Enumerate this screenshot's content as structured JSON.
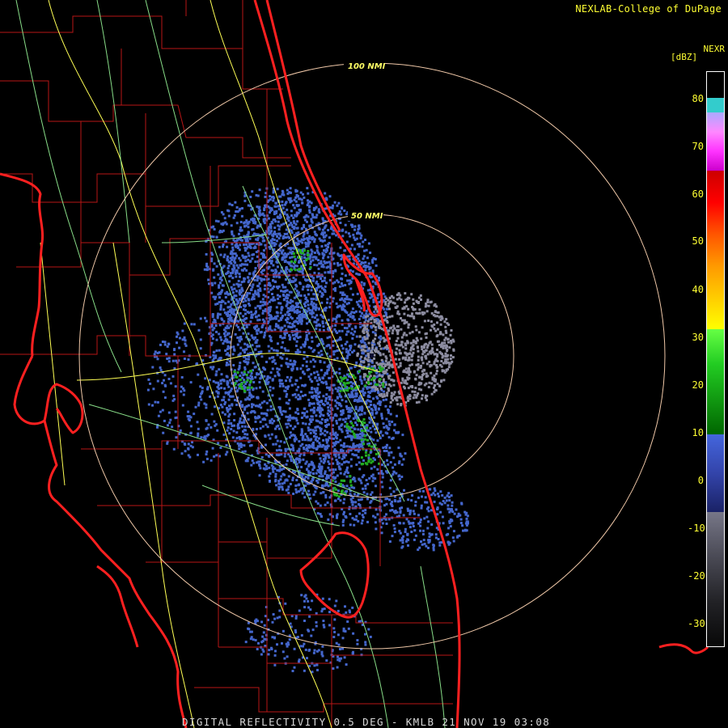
{
  "header": {
    "credit": "NEXLAB-College of DuPage",
    "product": "NEXR",
    "units": "[dBZ]"
  },
  "range_rings": [
    {
      "label": "100 NMI"
    },
    {
      "label": "50 NMI"
    }
  ],
  "legend": {
    "ticks": [
      "80",
      "70",
      "60",
      "50",
      "40",
      "30",
      "20",
      "10",
      "0",
      "-10",
      "-20",
      "-30"
    ]
  },
  "footer": {
    "caption": "DIGITAL REFLECTIVITY 0.5 DEG - KMLB 21 NOV 19 03:08"
  },
  "colors": {
    "background": "#000000",
    "coastline": "#ff2020",
    "county_lines": "#c01818",
    "roads_yellow": "#ffff55",
    "roads_green": "#88dd88",
    "range_ring": "#f0c8a8",
    "echo_blue": "#4466cc",
    "echo_gray": "#8c8ca0",
    "echo_green": "#22aa22",
    "text_yellow": "#ffff33"
  }
}
